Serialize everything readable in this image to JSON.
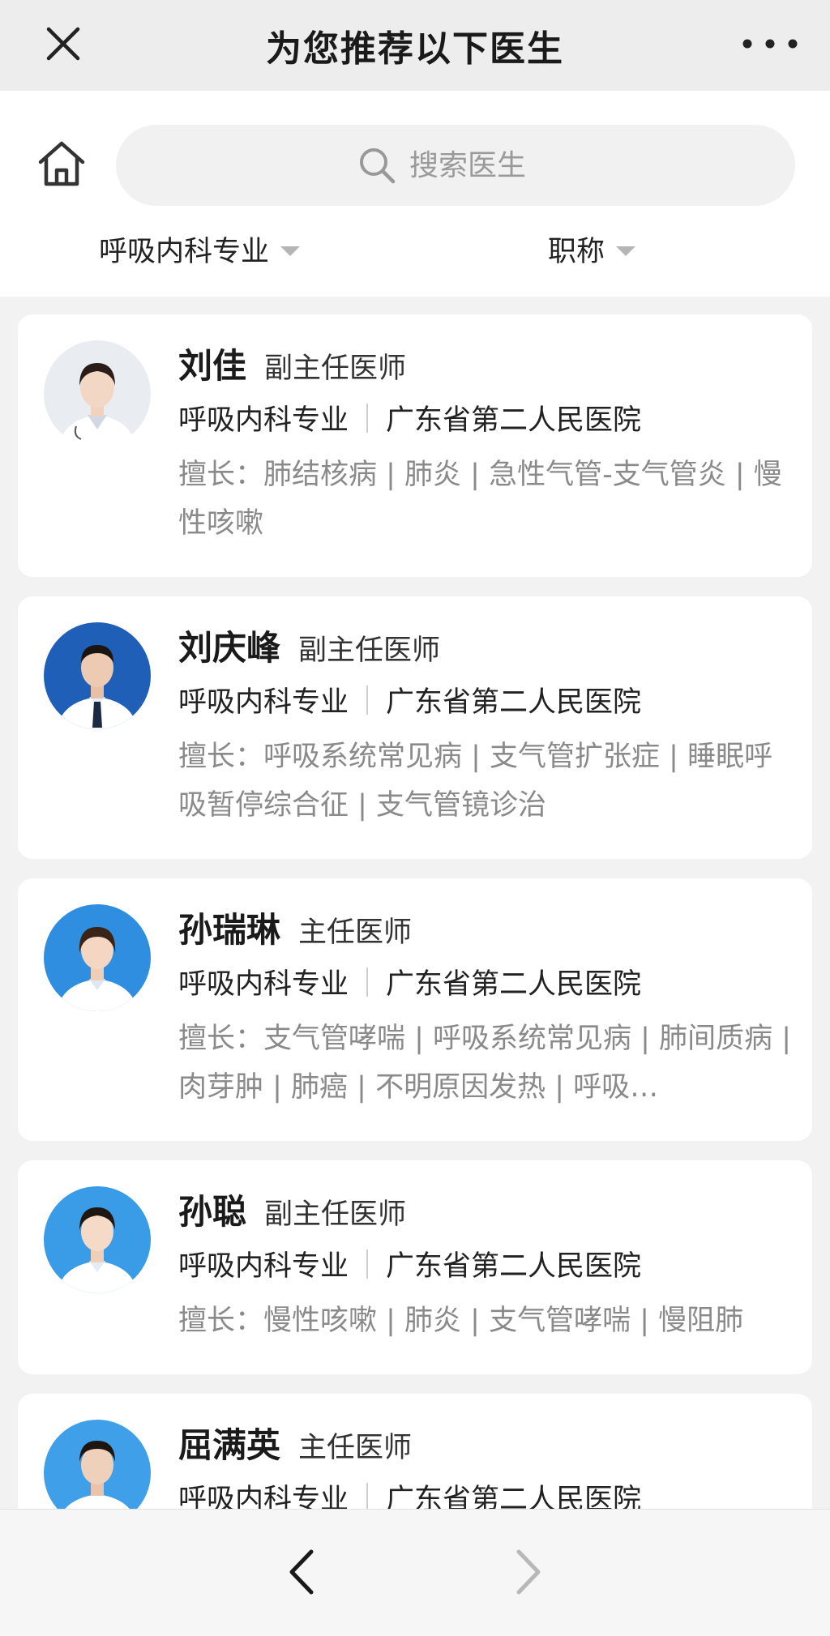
{
  "topbar": {
    "title": "为您推荐以下医生",
    "close_icon": "close-icon",
    "more_icon": "more-icon"
  },
  "search": {
    "placeholder": "搜索医生",
    "icon": "search-icon"
  },
  "filters": {
    "specialty": "呼吸内科专业",
    "title": "职称"
  },
  "doctors": [
    {
      "name": "刘佳",
      "rank": "副主任医师",
      "department": "呼吸内科专业",
      "hospital": "广东省第二人民医院",
      "expertise": "擅长：肺结核病 | 肺炎 | 急性气管-支气管炎 | 慢性咳嗽",
      "avatar_bg": "#e9edf2"
    },
    {
      "name": "刘庆峰",
      "rank": "副主任医师",
      "department": "呼吸内科专业",
      "hospital": "广东省第二人民医院",
      "expertise": "擅长：呼吸系统常见病 | 支气管扩张症 | 睡眠呼吸暂停综合征 | 支气管镜诊治",
      "avatar_bg": "#1f5fb8"
    },
    {
      "name": "孙瑞琳",
      "rank": "主任医师",
      "department": "呼吸内科专业",
      "hospital": "广东省第二人民医院",
      "expertise": "擅长：支气管哮喘 | 呼吸系统常见病 | 肺间质病 | 肉芽肿 | 肺癌 | 不明原因发热 | 呼吸…",
      "avatar_bg": "#2f8ee0"
    },
    {
      "name": "孙聪",
      "rank": "副主任医师",
      "department": "呼吸内科专业",
      "hospital": "广东省第二人民医院",
      "expertise": "擅长：慢性咳嗽 | 肺炎 | 支气管哮喘 | 慢阻肺",
      "avatar_bg": "#3a9be6"
    },
    {
      "name": "屈满英",
      "rank": "主任医师",
      "department": "呼吸内科专业",
      "hospital": "广东省第二人民医院",
      "expertise": "",
      "avatar_bg": "#3f9fe8"
    }
  ],
  "bottom_nav": {
    "back_icon": "chevron-left-icon",
    "forward_icon": "chevron-right-icon"
  }
}
